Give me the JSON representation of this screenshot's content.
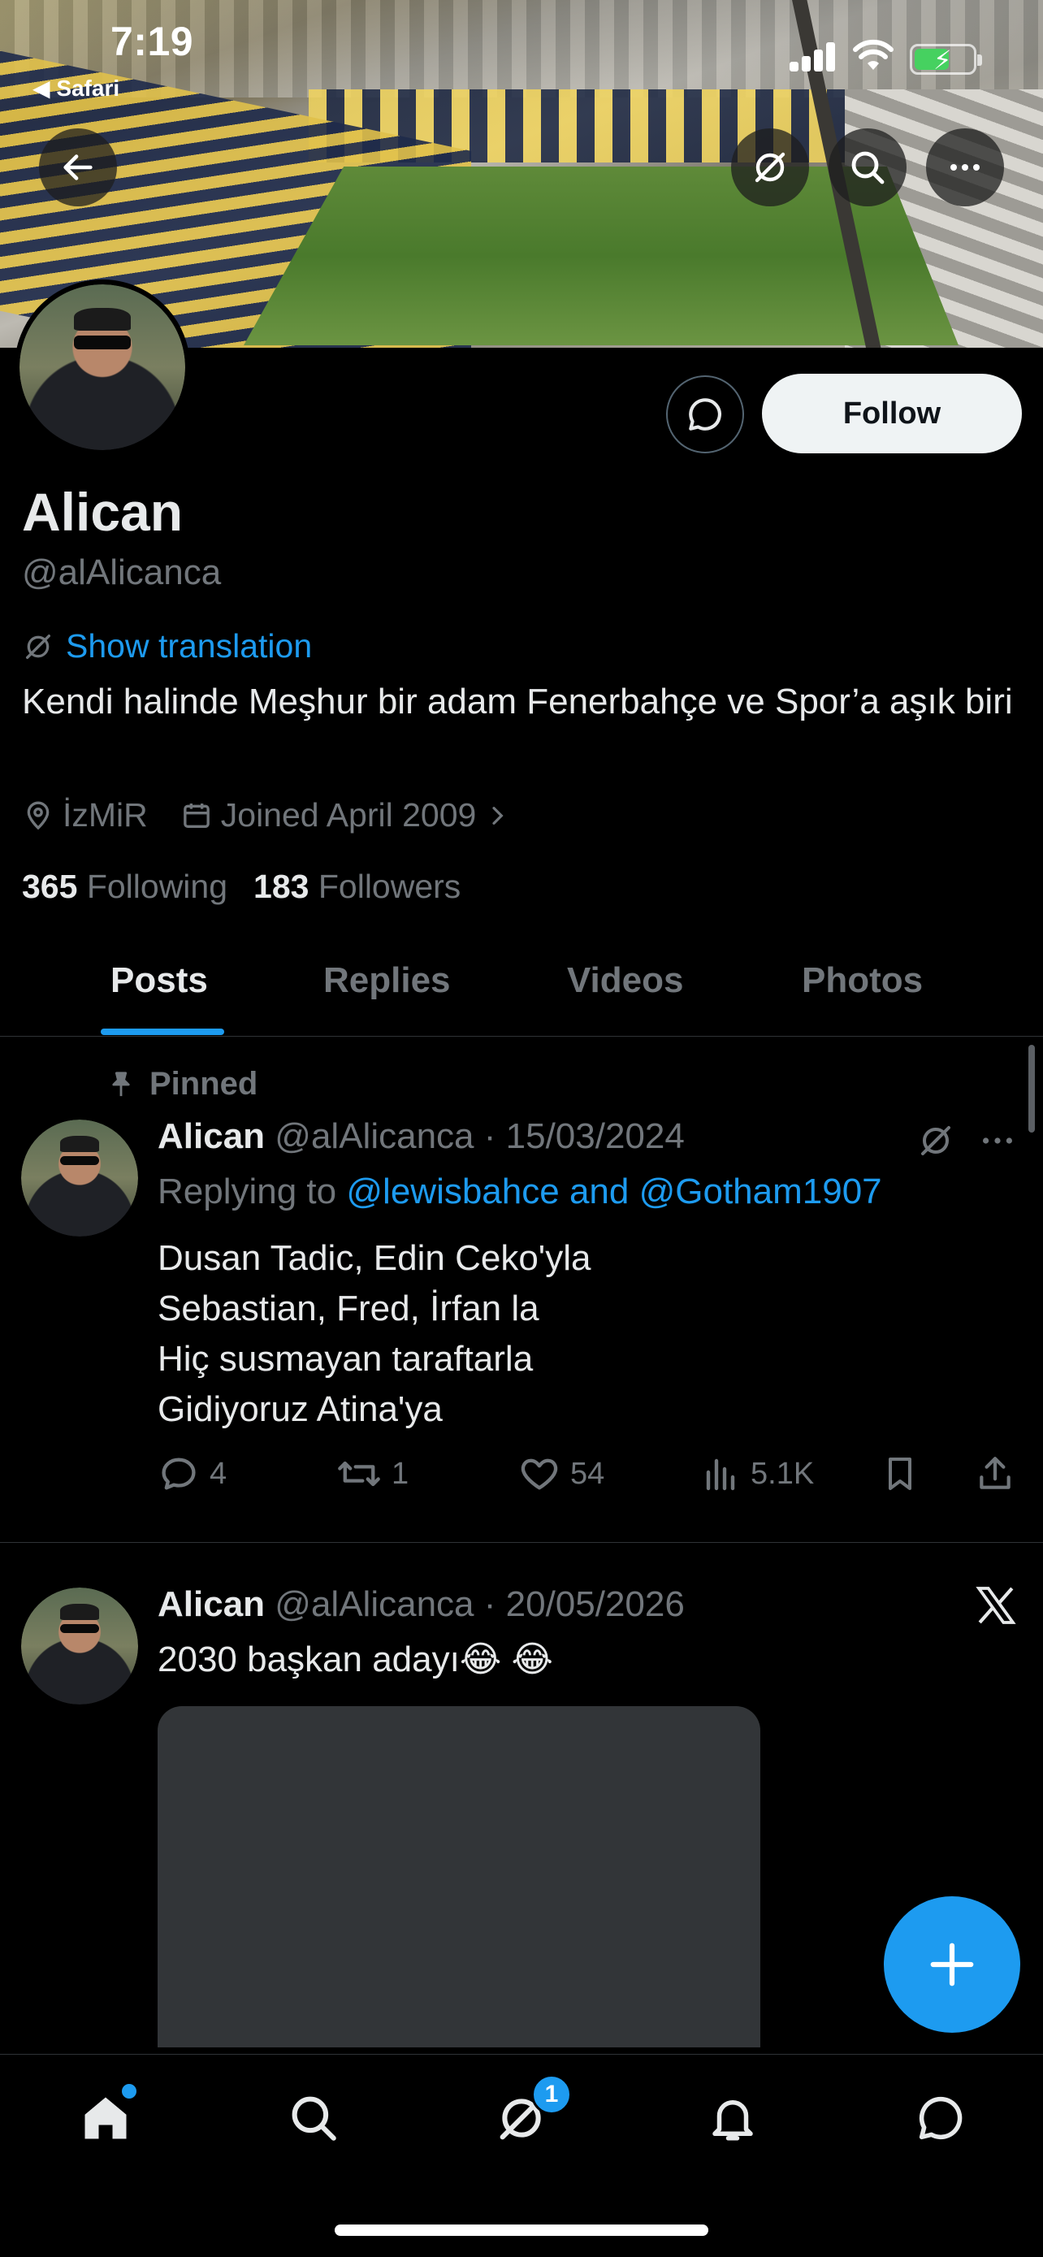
{
  "status_bar": {
    "time": "7:19",
    "back_app": "◀ Safari"
  },
  "profile": {
    "display_name": "Alican",
    "handle": "@alAlicanca",
    "follow_label": "Follow",
    "translation_label": "Show translation",
    "bio": "Kendi halinde Meşhur bir adam Fenerbahçe ve Spor’a aşık biri",
    "location": "İzMiR",
    "joined": "Joined April 2009",
    "following_count": "365",
    "following_label": "Following",
    "followers_count": "183",
    "followers_label": "Followers"
  },
  "tabs": [
    "Posts",
    "Replies",
    "Videos",
    "Photos"
  ],
  "active_tab": "Posts",
  "posts": [
    {
      "pinned_label": "Pinned",
      "name": "Alican",
      "handle": "@alAlicanca",
      "date": "· 15/03/2024",
      "reply_prefix": "Replying to",
      "reply_mentions": "@lewisbahce and @Gotham1907",
      "text": "Dusan Tadic, Edin Ceko'yla\nSebastian,  Fred, İrfan la\nHiç susmayan taraftarla\nGidiyoruz Atina'ya",
      "replies": "4",
      "reposts": "1",
      "likes": "54",
      "views": "5.1K"
    },
    {
      "name": "Alican",
      "handle": "@alAlicanca",
      "date": "· 20/05/2026",
      "text": "2030 başkan adayı😂 😂"
    }
  ],
  "nav": {
    "grok_badge": "1"
  },
  "colors": {
    "accent": "#1d9bf0",
    "background": "#000000",
    "muted": "#71767b"
  },
  "icons": [
    "back-arrow-icon",
    "grok-icon",
    "search-icon",
    "more-icon",
    "message-icon",
    "translate-icon",
    "location-icon",
    "calendar-icon",
    "chevron-right-icon",
    "pin-icon",
    "reply-icon",
    "repost-icon",
    "like-icon",
    "views-icon",
    "bookmark-icon",
    "share-icon",
    "x-logo-icon",
    "plus-icon",
    "home-icon",
    "notifications-icon",
    "messages-icon"
  ]
}
